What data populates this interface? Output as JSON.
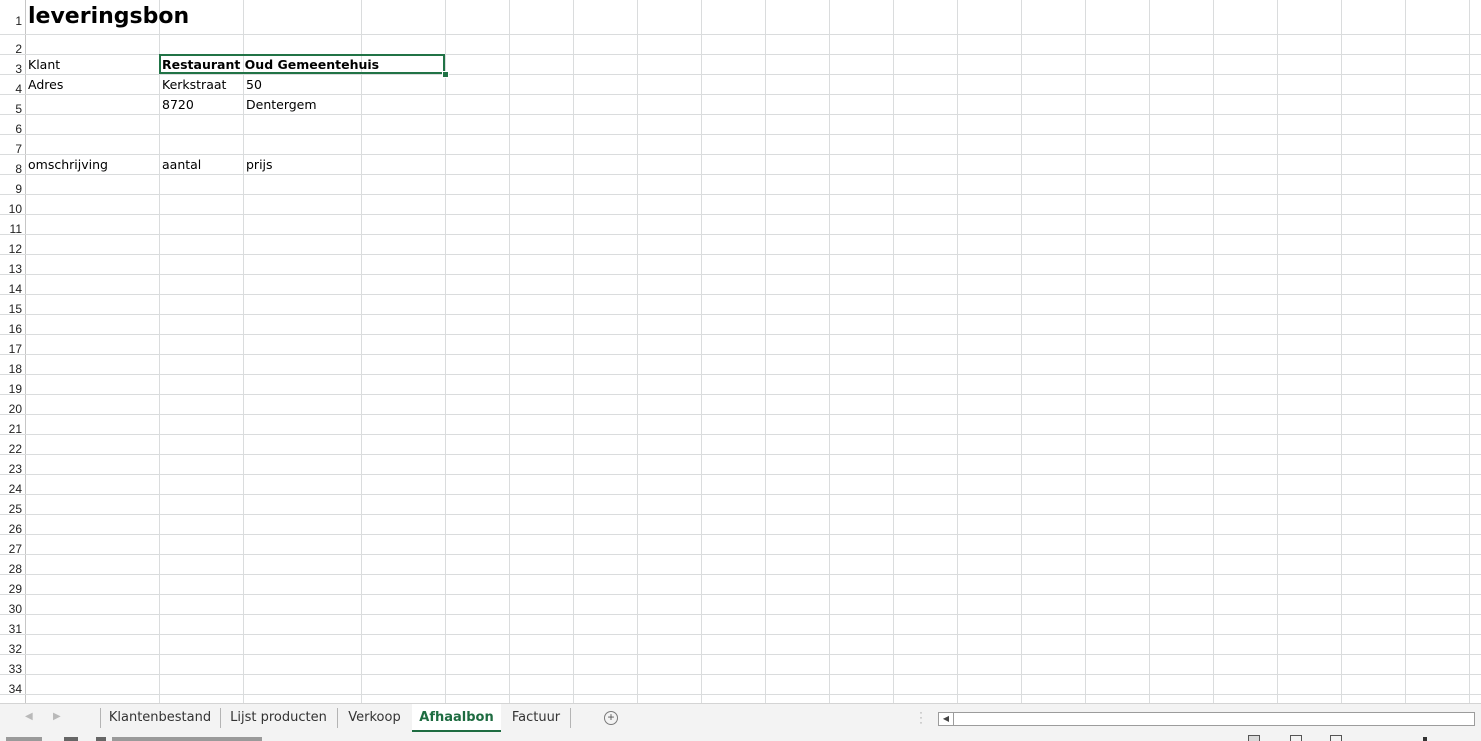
{
  "sheet": {
    "title": "leveringsbon",
    "row_headers": [
      "1",
      "2",
      "3",
      "4",
      "5",
      "6",
      "7",
      "8",
      "9",
      "10",
      "11",
      "12",
      "13",
      "14",
      "15",
      "16",
      "17",
      "18",
      "19",
      "20",
      "21",
      "22",
      "23",
      "24",
      "25",
      "26",
      "27",
      "28",
      "29",
      "30",
      "31",
      "32",
      "33",
      "34"
    ],
    "cells": {
      "a3": "Klant",
      "b3": "Restaurant Oud Gemeentehuis",
      "a4": "Adres",
      "b4": "Kerkstraat",
      "c4": "50",
      "b5": "8720",
      "c5": "Dentergem",
      "a8": "omschrijving",
      "b8": "aantal",
      "c8": "prijs"
    }
  },
  "tabs": [
    "Klantenbestand",
    "Lijst producten",
    "Verkoop",
    "Afhaalbon",
    "Factuur"
  ],
  "active_tab": "Afhaalbon",
  "icons": {
    "first_sheet": "nav-left-icon",
    "next_sheet": "nav-right-icon",
    "add_sheet": "plus-circle-icon",
    "scroll_left": "scroll-left-icon"
  },
  "colors": {
    "accent": "#217346",
    "active_tab_text": "#1e6c41",
    "gridline": "#dadcdd",
    "tabbar_bg": "#f3f3f3"
  }
}
